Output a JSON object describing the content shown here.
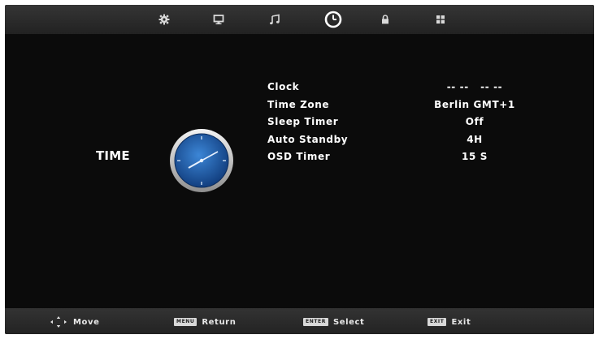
{
  "top_tabs": [
    {
      "icon": "gear-icon",
      "label": "Setup",
      "active": false
    },
    {
      "icon": "monitor-icon",
      "label": "Picture",
      "active": false
    },
    {
      "icon": "music-note-icon",
      "label": "Sound",
      "active": false
    },
    {
      "icon": "clock-icon",
      "label": "Time",
      "active": true
    },
    {
      "icon": "lock-icon",
      "label": "Lock",
      "active": false
    },
    {
      "icon": "apps-grid-icon",
      "label": "Channel",
      "active": false
    }
  ],
  "page": {
    "title": "TIME",
    "icon": "analog-clock-icon"
  },
  "menu": {
    "items": [
      {
        "label": "Clock",
        "value": "-- --   -- --"
      },
      {
        "label": "Time Zone",
        "value": "Berlin GMT+1"
      },
      {
        "label": "Sleep Timer",
        "value": "Off"
      },
      {
        "label": "Auto Standby",
        "value": "4H"
      },
      {
        "label": "OSD Timer",
        "value": "15 S"
      }
    ]
  },
  "footer": {
    "move": {
      "icon": "dpad-arrows-icon",
      "label": "Move"
    },
    "return": {
      "key": "MENU",
      "label": "Return"
    },
    "select": {
      "key": "ENTER",
      "label": "Select"
    },
    "exit": {
      "key": "EXIT",
      "label": "Exit"
    }
  },
  "colors": {
    "background": "#0b0b0b",
    "bar": "#2c2c2c",
    "text": "#ffffff",
    "clock_face": "#1f5ca8"
  }
}
